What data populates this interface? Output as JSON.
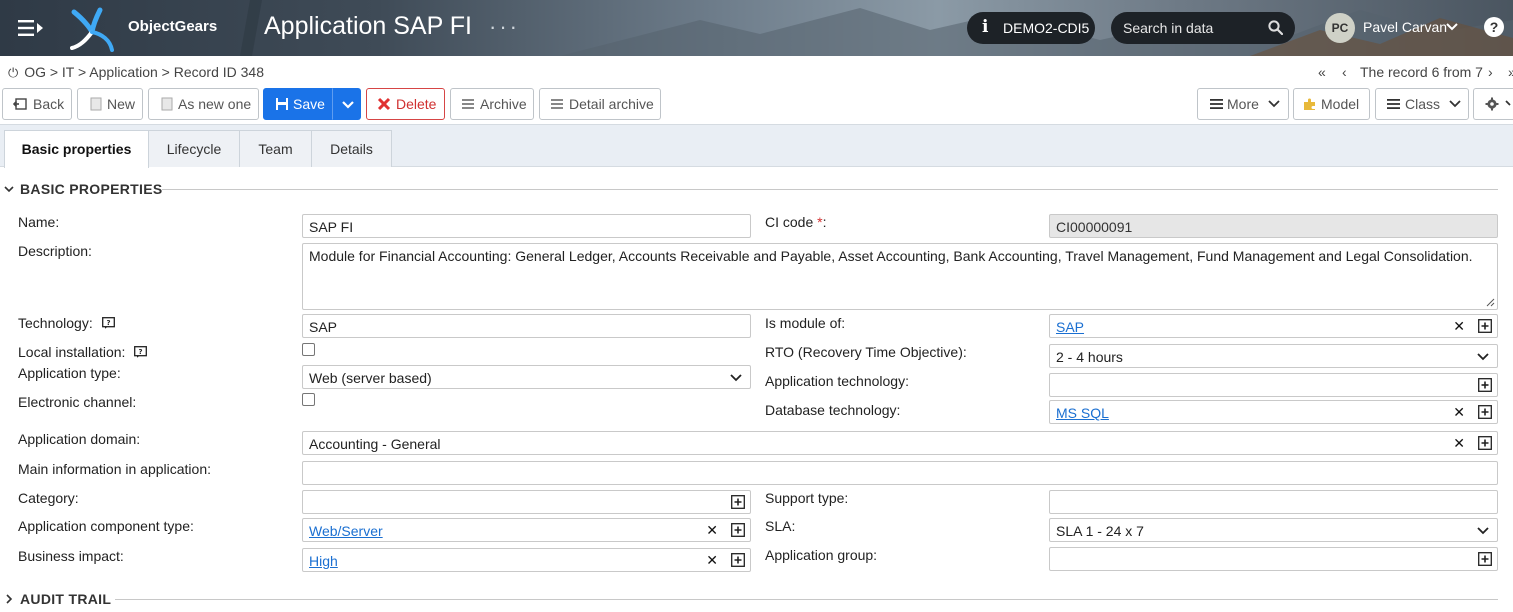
{
  "header": {
    "brand": "ObjectGears",
    "app_title": "Application SAP FI",
    "title_dots": "···",
    "environment": "DEMO2-CDI5",
    "environment_icon": "info-icon",
    "search_placeholder": "Search in data",
    "user_initials": "PC",
    "user_name": "Pavel Carvan",
    "help_label": "?"
  },
  "breadcrumb": {
    "root_icon": "⏻",
    "path": "OG > IT > Application > Record ID 348"
  },
  "record_nav": {
    "text": "The record 6 from 7",
    "first": "«",
    "prev": "‹",
    "next": "›",
    "last": "»"
  },
  "toolbar": {
    "back": "Back",
    "new": "New",
    "as_new_one": "As new one",
    "save": "Save",
    "delete": "Delete",
    "archive": "Archive",
    "detail_archive": "Detail archive",
    "more": "More",
    "model": "Model",
    "class": "Class"
  },
  "tabs": [
    {
      "label": "Basic properties"
    },
    {
      "label": "Lifecycle"
    },
    {
      "label": "Team"
    },
    {
      "label": "Details"
    }
  ],
  "section_basic": "BASIC PROPERTIES",
  "section_audit": "AUDIT TRAIL",
  "fields": {
    "name": {
      "label": "Name:",
      "value": "SAP FI"
    },
    "ci_code": {
      "label": "CI code",
      "required_mark": "*",
      "colon": ":",
      "value": "CI00000091"
    },
    "description": {
      "label": "Description:",
      "value": "Module for Financial Accounting: General Ledger, Accounts Receivable and Payable, Asset Accounting, Bank Accounting, Travel Management, Fund Management and Legal Consolidation."
    },
    "technology": {
      "label": "Technology:",
      "value": "SAP"
    },
    "is_module_of": {
      "label": "Is module of:",
      "value": "SAP"
    },
    "local_installation": {
      "label": "Local installation:",
      "checked": false
    },
    "rto": {
      "label": "RTO (Recovery Time Objective):",
      "value": "2 - 4 hours"
    },
    "application_type": {
      "label": "Application type:",
      "value": "Web (server based)"
    },
    "application_technology": {
      "label": "Application technology:",
      "value": ""
    },
    "electronic_channel": {
      "label": "Electronic channel:",
      "checked": false
    },
    "database_technology": {
      "label": "Database technology:",
      "value": "MS SQL"
    },
    "application_domain": {
      "label": "Application domain:",
      "value": "Accounting - General"
    },
    "main_information": {
      "label": "Main information in application:",
      "value": ""
    },
    "category": {
      "label": "Category:",
      "value": ""
    },
    "support_type": {
      "label": "Support type:",
      "value": ""
    },
    "component_type": {
      "label": "Application component type:",
      "value": "Web/Server"
    },
    "sla": {
      "label": "SLA:",
      "value": "SLA 1 - 24 x 7"
    },
    "business_impact": {
      "label": "Business impact:",
      "value": "High"
    },
    "application_group": {
      "label": "Application group:",
      "value": ""
    }
  },
  "colors": {
    "primary": "#1a73e8",
    "danger": "#d03030",
    "link": "#1a6fd1",
    "tabbar": "#e9eef4"
  },
  "clear_glyph": "✕"
}
